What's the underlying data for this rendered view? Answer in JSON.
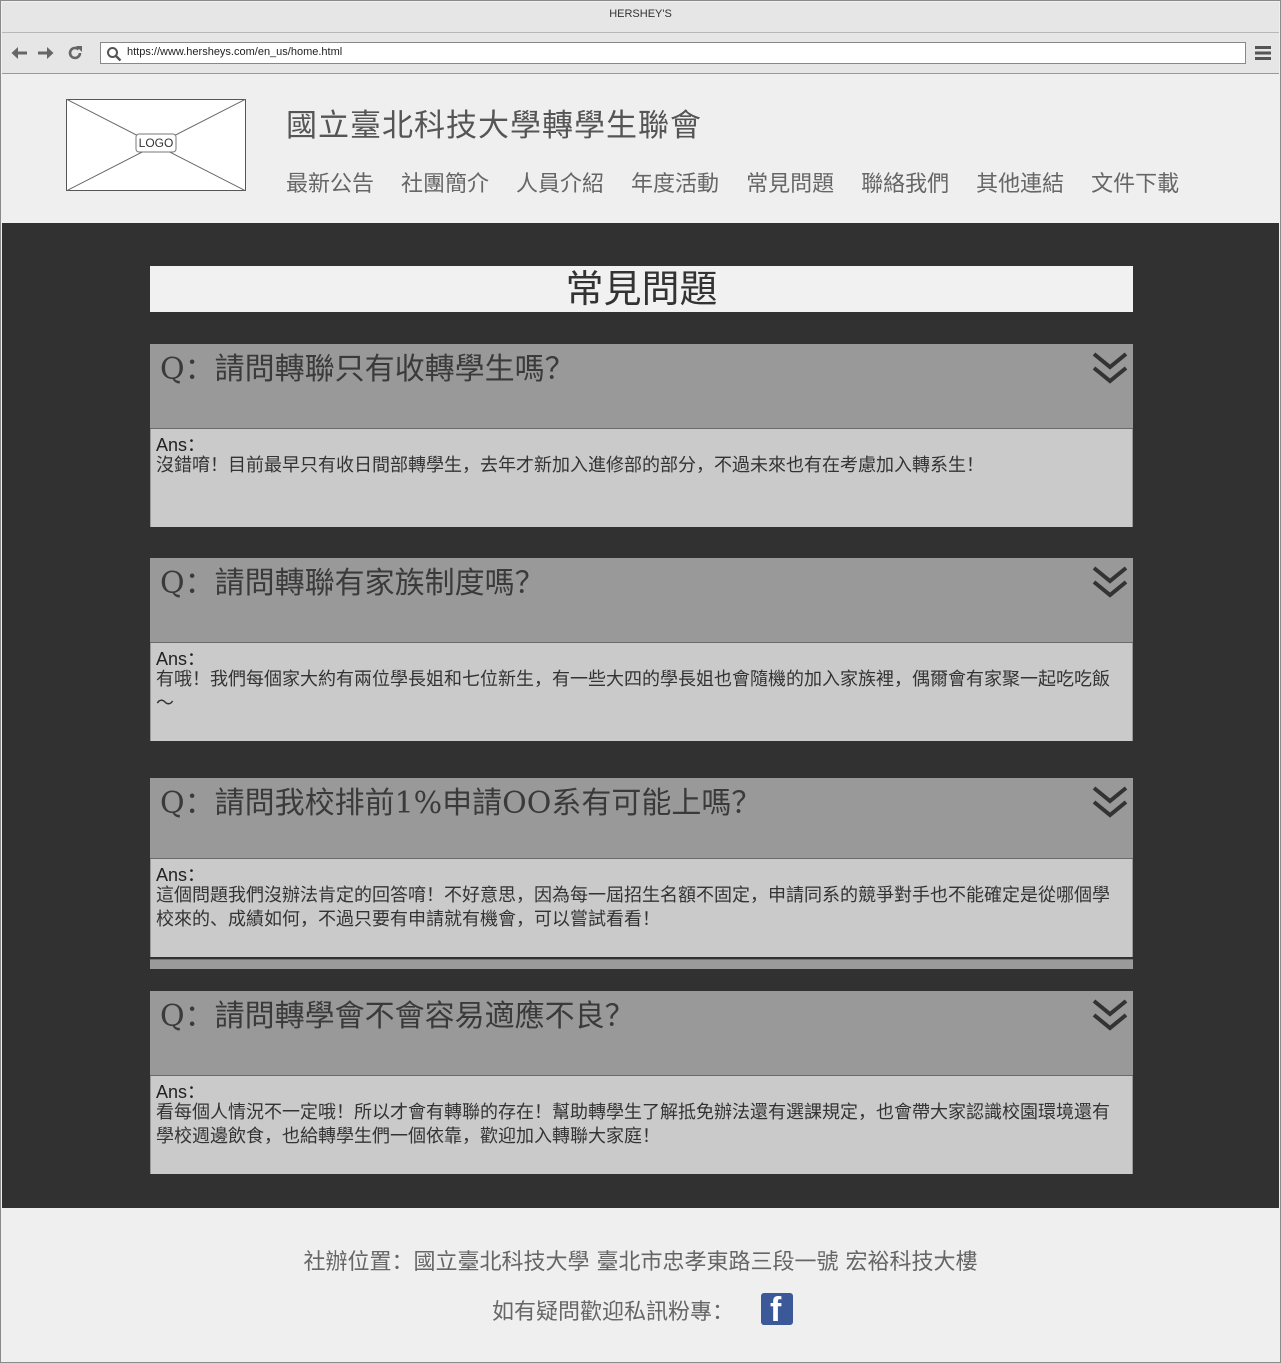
{
  "browser": {
    "window_title": "HERSHEY'S",
    "url": "https://www.hersheys.com/en_us/home.html",
    "icons": [
      "back-arrow-icon",
      "forward-arrow-icon",
      "reload-icon",
      "search-icon",
      "hamburger-menu-icon"
    ]
  },
  "header": {
    "logo_label": "LOGO",
    "site_title": "國立臺北科技大學轉學生聯會",
    "nav": [
      {
        "label": "最新公告"
      },
      {
        "label": "社團簡介"
      },
      {
        "label": "人員介紹"
      },
      {
        "label": "年度活動"
      },
      {
        "label": "常見問題"
      },
      {
        "label": "聯絡我們"
      },
      {
        "label": "其他連結"
      },
      {
        "label": "文件下載"
      }
    ]
  },
  "main": {
    "page_title": "常見問題",
    "faqs": [
      {
        "question": "Q：請問轉聯只有收轉學生嗎？",
        "answer_label": "Ans：",
        "answer": "沒錯唷！目前最早只有收日間部轉學生，去年才新加入進修部的部分，不過未來也有在考慮加入轉系生！"
      },
      {
        "question": "Q：請問轉聯有家族制度嗎？",
        "answer_label": "Ans：",
        "answer": "有哦！我們每個家大約有兩位學長姐和七位新生，有一些大四的學長姐也會隨機的加入家族裡，偶爾會有家聚一起吃吃飯～"
      },
      {
        "question": "Q：請問我校排前1%申請OO系有可能上嗎？",
        "answer_label": "Ans：",
        "answer": "這個問題我們沒辦法肯定的回答唷！不好意思，因為每一屆招生名額不固定，申請同系的競爭對手也不能確定是從哪個學校來的、成績如何，不過只要有申請就有機會，可以嘗試看看！"
      },
      {
        "question": "Q：請問轉學會不會容易適應不良？",
        "answer_label": "Ans：",
        "answer": "看每個人情況不一定哦！所以才會有轉聯的存在！幫助轉學生了解抵免辦法還有選課規定，也會帶大家認識校園環境還有學校週邊飲食，也給轉學生們一個依靠，歡迎加入轉聯大家庭！"
      }
    ],
    "expand_icon": "double-chevron-down-icon"
  },
  "footer": {
    "address": "社辦位置：國立臺北科技大學  臺北市忠孝東路三段一號  宏裕科技大樓",
    "contact": "如有疑問歡迎私訊粉專：",
    "social_icon": "facebook-icon",
    "colors": {
      "facebook": "#3b5998",
      "main_bg": "#313131",
      "question_bg": "#999999",
      "answer_bg": "#cacaca"
    }
  }
}
